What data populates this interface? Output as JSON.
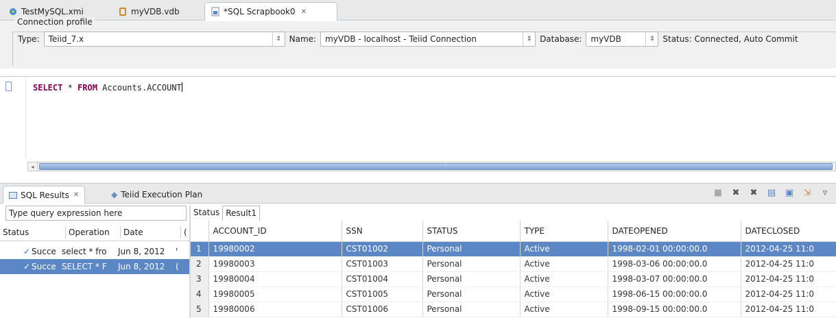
{
  "editor_tabs": [
    {
      "label": "TestMySQL.xmi",
      "icon": "model-icon",
      "active": false
    },
    {
      "label": "myVDB.vdb",
      "icon": "vdb-icon",
      "active": false
    },
    {
      "label": "*SQL Scrapbook0",
      "icon": "sql-file-icon",
      "active": true,
      "close": "✕"
    }
  ],
  "connection": {
    "group_label": "Connection profile",
    "type_label": "Type:",
    "type_value": "Teiid_7.x",
    "name_label": "Name:",
    "name_value": "myVDB - localhost - Teiid Connection",
    "database_label": "Database:",
    "database_value": "myVDB",
    "status_text": "Status: Connected, Auto Commit"
  },
  "editor": {
    "kw1": "SELECT",
    "star": " * ",
    "kw2": "FROM",
    "rest": " Accounts.ACCOUNT"
  },
  "results_tabs": [
    {
      "label": "SQL Results",
      "close": "✕",
      "active": true
    },
    {
      "label": "Teiid Execution Plan",
      "active": false
    }
  ],
  "toolbar_icons": [
    "stop-icon",
    "remove-icon",
    "remove-all-icon",
    "export-icon",
    "save-icon",
    "pin-icon",
    "menu-icon"
  ],
  "history": {
    "filter_placeholder": "Type query expression here",
    "columns": [
      "Status",
      "Operation",
      "Date",
      "("
    ],
    "rows": [
      {
        "status": "Succe",
        "operation": "select * fro",
        "date": "Jun 8, 2012",
        "more": "'",
        "selected": false
      },
      {
        "status": "Succe",
        "operation": "SELECT * F",
        "date": "Jun 8, 2012",
        "more": "(",
        "selected": true
      }
    ]
  },
  "result_subtabs": [
    "Status",
    "Result1"
  ],
  "grid": {
    "columns": [
      "",
      "ACCOUNT_ID",
      "SSN",
      "STATUS",
      "TYPE",
      "DATEOPENED",
      "DATECLOSED"
    ],
    "rows": [
      [
        "1",
        "19980002",
        "CST01002",
        "Personal",
        "Active",
        "1998-02-01 00:00:00.0",
        "2012-04-25 11:0"
      ],
      [
        "2",
        "19980003",
        "CST01003",
        "Personal",
        "Active",
        "1998-03-06 00:00:00.0",
        "2012-04-25 11:0"
      ],
      [
        "3",
        "19980004",
        "CST01004",
        "Personal",
        "Active",
        "1998-03-07 00:00:00.0",
        "2012-04-25 11:0"
      ],
      [
        "4",
        "19980005",
        "CST01005",
        "Personal",
        "Active",
        "1998-06-15 00:00:00.0",
        "2012-04-25 11:0"
      ],
      [
        "5",
        "19980006",
        "CST01006",
        "Personal",
        "Active",
        "1998-09-15 00:00:00.0",
        "2012-04-25 11:0"
      ]
    ],
    "selected_row": 0
  },
  "colors": {
    "selection": "#5b87c5",
    "keyword": "#7f0055"
  }
}
